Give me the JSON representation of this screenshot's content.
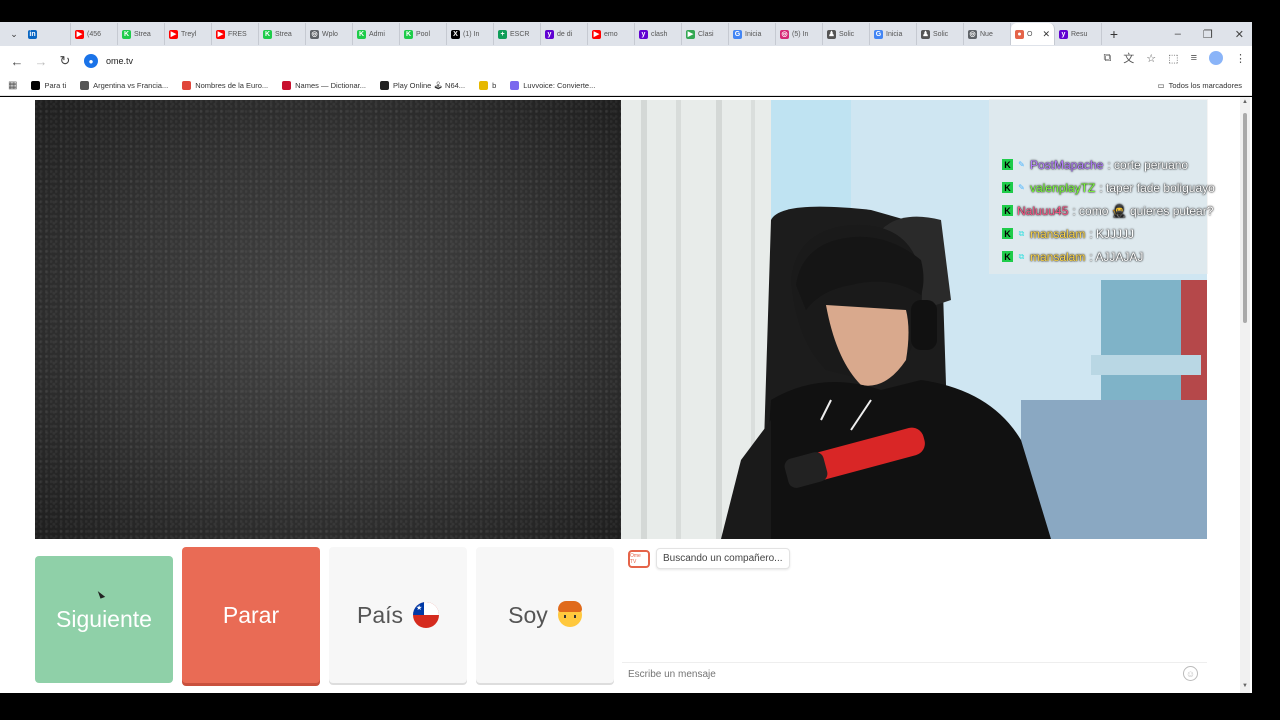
{
  "browser": {
    "tabs": [
      {
        "label": "",
        "icon": "linkedin-icon",
        "color": "#0a66c2",
        "glyph": "in"
      },
      {
        "label": "(456",
        "icon": "youtube-icon",
        "color": "#ff0000",
        "glyph": "▶"
      },
      {
        "label": "Strea",
        "icon": "kick-icon",
        "color": "#1ecc4a",
        "glyph": "K"
      },
      {
        "label": "Treyl",
        "icon": "youtube-icon",
        "color": "#ff0000",
        "glyph": "▶"
      },
      {
        "label": "FRES",
        "icon": "youtube-icon",
        "color": "#ff0000",
        "glyph": "▶"
      },
      {
        "label": "Strea",
        "icon": "kick-icon",
        "color": "#1ecc4a",
        "glyph": "K"
      },
      {
        "label": "Wplo",
        "icon": "globe-icon",
        "color": "#5f6368",
        "glyph": "◎"
      },
      {
        "label": "Admi",
        "icon": "kick-icon",
        "color": "#1ecc4a",
        "glyph": "K"
      },
      {
        "label": "Pool",
        "icon": "kick-icon",
        "color": "#1ecc4a",
        "glyph": "K"
      },
      {
        "label": "(1) In",
        "icon": "x-icon",
        "color": "#000000",
        "glyph": "X"
      },
      {
        "label": "ESCR",
        "icon": "sheets-icon",
        "color": "#0f9d58",
        "glyph": "+"
      },
      {
        "label": "de di",
        "icon": "yahoo-icon",
        "color": "#6001d2",
        "glyph": "y"
      },
      {
        "label": "emo",
        "icon": "youtube-icon",
        "color": "#ff0000",
        "glyph": "▶"
      },
      {
        "label": "clash",
        "icon": "yahoo-icon",
        "color": "#6001d2",
        "glyph": "y"
      },
      {
        "label": "Clasi",
        "icon": "play-icon",
        "color": "#34a853",
        "glyph": "▶"
      },
      {
        "label": "Inicia",
        "icon": "google-icon",
        "color": "#4285f4",
        "glyph": "G"
      },
      {
        "label": "(5) In",
        "icon": "instagram-icon",
        "color": "#d62976",
        "glyph": "◎"
      },
      {
        "label": "Solic",
        "icon": "steam-icon",
        "color": "#555555",
        "glyph": "♟"
      },
      {
        "label": "Inicia",
        "icon": "google-icon",
        "color": "#4285f4",
        "glyph": "G"
      },
      {
        "label": "Solic",
        "icon": "steam-icon",
        "color": "#555555",
        "glyph": "♟"
      },
      {
        "label": "Nue",
        "icon": "globe-icon",
        "color": "#5f6368",
        "glyph": "◎"
      },
      {
        "label": "O",
        "icon": "ometv-icon",
        "color": "#e56449",
        "glyph": "●",
        "active": true
      },
      {
        "label": "Resu",
        "icon": "yahoo-icon",
        "color": "#6001d2",
        "glyph": "y"
      }
    ],
    "new_tab": "+",
    "url": "ome.tv",
    "bookmarks": [
      {
        "label": "Para ti",
        "color": "#000000"
      },
      {
        "label": "Argentina vs Francia...",
        "color": "#555555"
      },
      {
        "label": "Nombres de la Euro...",
        "color": "#e0463a"
      },
      {
        "label": "Names — Dictionar...",
        "color": "#c8102e"
      },
      {
        "label": "Play Online 🕹 N64...",
        "color": "#222222"
      },
      {
        "label": "b",
        "color": "#e6b800"
      },
      {
        "label": "Luvvoice: Convierte...",
        "color": "#7b68ee"
      }
    ],
    "all_bookmarks": "Todos los marcadores"
  },
  "chat": {
    "messages": [
      {
        "user": "PostMapache",
        "user_color": "#b47dff",
        "badge": "✎",
        "badge_color": "#4ab4ff",
        "text": ": corte peruano"
      },
      {
        "user": "valenplayTZ",
        "user_color": "#7dff3c",
        "badge": "✎",
        "badge_color": "#4ab4ff",
        "text": ": taper fade boliguayo"
      },
      {
        "user": "Naluuu45",
        "user_color": "#ff5a8a",
        "badge": "",
        "badge_color": "",
        "text": ": como 🥷 quieres putear?"
      },
      {
        "user": "mansalam",
        "user_color": "#ffd84a",
        "badge": "⧉",
        "badge_color": "#3de0e0",
        "text": ": KJJJJJ"
      },
      {
        "user": "mansalam",
        "user_color": "#ffd84a",
        "badge": "⧉",
        "badge_color": "#3de0e0",
        "text": ": AJJAJAJ"
      }
    ]
  },
  "controls": {
    "next_label": "Siguiente",
    "stop_label": "Parar",
    "country_label": "País",
    "gender_label": "Soy"
  },
  "status": {
    "logo_text": "Ome TV",
    "text": "Buscando un compañero..."
  },
  "message_input": {
    "placeholder": "Escribe un mensaje"
  }
}
